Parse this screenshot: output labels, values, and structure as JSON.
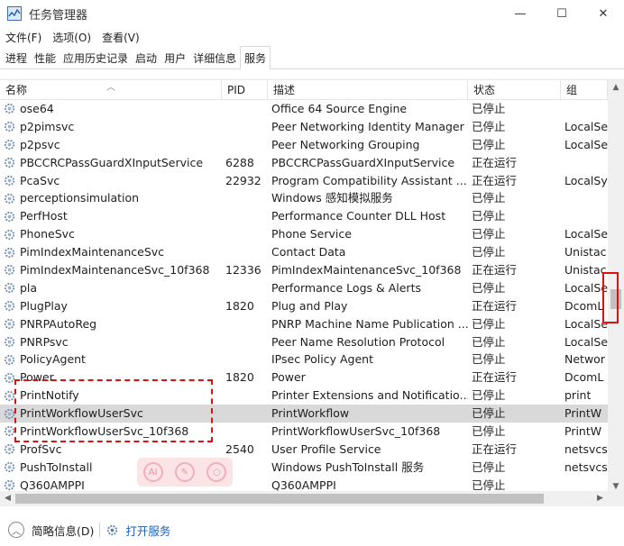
{
  "window": {
    "title": "任务管理器",
    "minimize": "—",
    "maximize": "☐",
    "close": "✕"
  },
  "menu": [
    "文件(F)",
    "选项(O)",
    "查看(V)"
  ],
  "tabs": [
    "进程",
    "性能",
    "应用历史记录",
    "启动",
    "用户",
    "详细信息",
    "服务"
  ],
  "active_tab": "服务",
  "columns": {
    "name": "名称",
    "pid": "PID",
    "desc": "描述",
    "status": "状态",
    "group": "组"
  },
  "rows": [
    {
      "name": "ose64",
      "pid": "",
      "desc": "Office 64 Source Engine",
      "status": "已停止",
      "group": ""
    },
    {
      "name": "p2pimsvc",
      "pid": "",
      "desc": "Peer Networking Identity Manager",
      "status": "已停止",
      "group": "LocalSe"
    },
    {
      "name": "p2psvc",
      "pid": "",
      "desc": "Peer Networking Grouping",
      "status": "已停止",
      "group": "LocalSe"
    },
    {
      "name": "PBCCRCPassGuardXInputService",
      "pid": "6288",
      "desc": "PBCCRCPassGuardXInputService",
      "status": "正在运行",
      "group": ""
    },
    {
      "name": "PcaSvc",
      "pid": "22932",
      "desc": "Program Compatibility Assistant ...",
      "status": "正在运行",
      "group": "LocalSy"
    },
    {
      "name": "perceptionsimulation",
      "pid": "",
      "desc": "Windows 感知模拟服务",
      "status": "已停止",
      "group": ""
    },
    {
      "name": "PerfHost",
      "pid": "",
      "desc": "Performance Counter DLL Host",
      "status": "已停止",
      "group": ""
    },
    {
      "name": "PhoneSvc",
      "pid": "",
      "desc": "Phone Service",
      "status": "已停止",
      "group": "LocalSe"
    },
    {
      "name": "PimIndexMaintenanceSvc",
      "pid": "",
      "desc": "Contact Data",
      "status": "已停止",
      "group": "Unistac"
    },
    {
      "name": "PimIndexMaintenanceSvc_10f368",
      "pid": "12336",
      "desc": "PimIndexMaintenanceSvc_10f368",
      "status": "正在运行",
      "group": "Unistac"
    },
    {
      "name": "pla",
      "pid": "",
      "desc": "Performance Logs & Alerts",
      "status": "已停止",
      "group": "LocalSe"
    },
    {
      "name": "PlugPlay",
      "pid": "1820",
      "desc": "Plug and Play",
      "status": "正在运行",
      "group": "DcomL"
    },
    {
      "name": "PNRPAutoReg",
      "pid": "",
      "desc": "PNRP Machine Name Publication ...",
      "status": "已停止",
      "group": "LocalSe"
    },
    {
      "name": "PNRPsvc",
      "pid": "",
      "desc": "Peer Name Resolution Protocol",
      "status": "已停止",
      "group": "LocalSe"
    },
    {
      "name": "PolicyAgent",
      "pid": "",
      "desc": "IPsec Policy Agent",
      "status": "已停止",
      "group": "Networ"
    },
    {
      "name": "Power",
      "pid": "1820",
      "desc": "Power",
      "status": "正在运行",
      "group": "DcomL"
    },
    {
      "name": "PrintNotify",
      "pid": "",
      "desc": "Printer Extensions and Notificatio...",
      "status": "已停止",
      "group": "print"
    },
    {
      "name": "PrintWorkflowUserSvc",
      "pid": "",
      "desc": "PrintWorkflow",
      "status": "已停止",
      "group": "PrintW"
    },
    {
      "name": "PrintWorkflowUserSvc_10f368",
      "pid": "",
      "desc": "PrintWorkflowUserSvc_10f368",
      "status": "已停止",
      "group": "PrintW"
    },
    {
      "name": "ProfSvc",
      "pid": "2540",
      "desc": "User Profile Service",
      "status": "正在运行",
      "group": "netsvcs"
    },
    {
      "name": "PushToInstall",
      "pid": "",
      "desc": "Windows PushToInstall 服务",
      "status": "已停止",
      "group": "netsvcs"
    },
    {
      "name": "Q360AMPPI",
      "pid": "",
      "desc": "Q360AMPPI",
      "status": "已停止",
      "group": ""
    }
  ],
  "selected_row": "PrintWorkflowUserSvc",
  "footer": {
    "brief": "简略信息(D)",
    "open_services": "打开服务"
  },
  "colors": {
    "highlight": "#d11111",
    "link": "#1f5fb5",
    "selection": "#d9d9d9"
  }
}
